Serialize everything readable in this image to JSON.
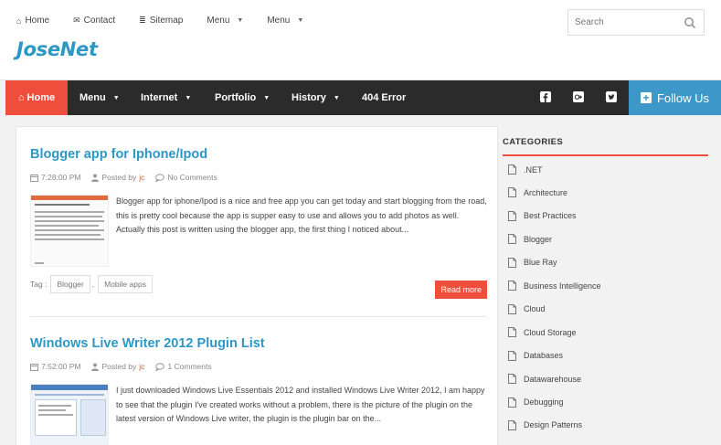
{
  "toplinks": [
    {
      "icon": "home-icon",
      "label": "Home",
      "glyph": "⌂",
      "caret": false
    },
    {
      "icon": "envelope-icon",
      "label": "Contact",
      "glyph": "✉",
      "caret": false
    },
    {
      "icon": "sitemap-icon",
      "label": "Sitemap",
      "glyph": "≣",
      "caret": false
    },
    {
      "icon": "",
      "label": "Menu",
      "glyph": "",
      "caret": true
    },
    {
      "icon": "",
      "label": "Menu",
      "glyph": "",
      "caret": true
    }
  ],
  "search": {
    "placeholder": "Search"
  },
  "logo": "JoseNet",
  "nav": {
    "home": "⌂ Home",
    "items": [
      "Menu",
      "Internet",
      "Portfolio",
      "History",
      "404 Error"
    ],
    "follow": "Follow Us"
  },
  "posts": [
    {
      "title": "Blogger app for Iphone/Ipod",
      "time": "7:28:00 PM",
      "posted_by": "Posted by",
      "author": "jc",
      "comments": "No Comments",
      "excerpt": "Blogger app for iphone/Ipod is a nice and free app you can get today and start blogging from the road, this is pretty cool because the app is supper easy to use and allows you to add photos as well. Actually this post is written using the blogger app, the first thing I noticed about...",
      "tag_label": "Tag :",
      "tags": [
        "Blogger",
        "Mobile apps"
      ],
      "read_more": "Read more"
    },
    {
      "title": "Windows Live Writer 2012 Plugin List",
      "time": "7:52:00 PM",
      "posted_by": "Posted by",
      "author": "jc",
      "comments": "1 Comments",
      "excerpt": "I just downloaded Windows Live Essentials 2012 and installed Windows Live Writer 2012, I am happy to see that the plugin I've created works without a problem, there is the picture of the plugin on the latest version of Windows Live writer, the plugin is the plugin bar on the..."
    }
  ],
  "sidebar": {
    "heading": "CATEGORIES",
    "categories": [
      ".NET",
      "Architecture",
      "Best Practices",
      "Blogger",
      "Blue Ray",
      "Business Intelligence",
      "Cloud",
      "Cloud Storage",
      "Databases",
      "Datawarehouse",
      "Debugging",
      "Design Patterns"
    ]
  },
  "colors": {
    "accent": "#ee4e3b",
    "brand": "#2d98c5",
    "nav_bg": "#2b2b2b",
    "follow_bg": "#3d97c9"
  }
}
